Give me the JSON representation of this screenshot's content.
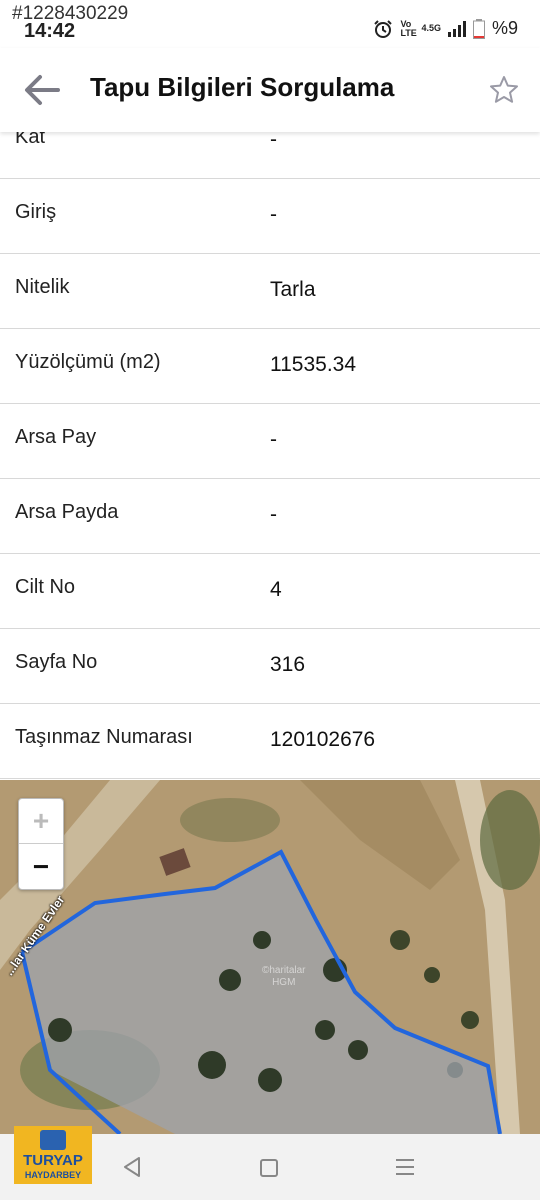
{
  "status": {
    "id_text": "#1228430229",
    "time": "14:42",
    "volte": "Vo LTE",
    "network": "4.5G",
    "battery": "%9"
  },
  "appbar": {
    "title": "Tapu Bilgileri Sorgulama"
  },
  "rows": [
    {
      "label": "Kat",
      "value": "-"
    },
    {
      "label": "Giriş",
      "value": "-"
    },
    {
      "label": "Nitelik",
      "value": "Tarla"
    },
    {
      "label": "Yüzölçümü (m2)",
      "value": "11535.34"
    },
    {
      "label": "Arsa Pay",
      "value": "-"
    },
    {
      "label": "Arsa Payda",
      "value": "-"
    },
    {
      "label": "Cilt No",
      "value": "4"
    },
    {
      "label": "Sayfa No",
      "value": "316"
    },
    {
      "label": "Taşınmaz Numarası",
      "value": "120102676"
    }
  ],
  "map": {
    "zoom_in": "+",
    "zoom_out": "−",
    "road_label": "...lar Küme Evler",
    "watermark_line1": "©haritalar",
    "watermark_line2": "HGM",
    "parcel_color": "#2266dd"
  },
  "watermark_logo": {
    "brand": "TURYAP",
    "sub": "HAYDARBEY"
  }
}
